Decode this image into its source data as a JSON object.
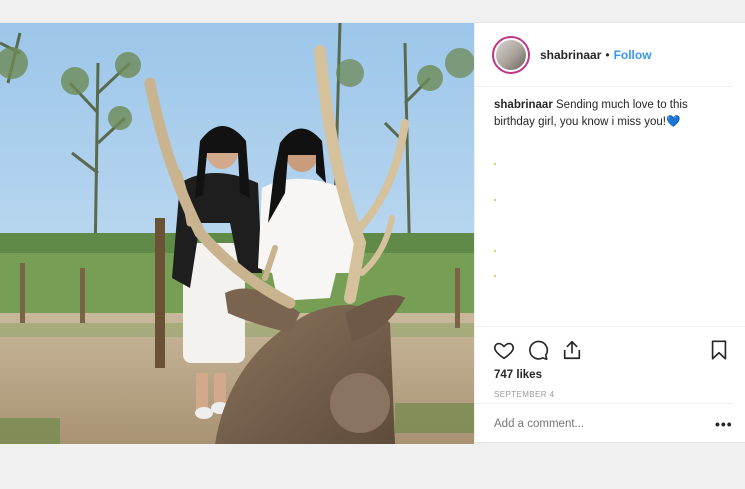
{
  "post": {
    "username": "shabrinaar",
    "separator": "•",
    "follow_label": "Follow",
    "caption_username": "shabrinaar",
    "caption_text": "Sending much love to this birthday girl, you know i miss you!",
    "caption_emoji": "💙",
    "likes": "747 likes",
    "date": "SEPTEMBER 4",
    "comment_placeholder": "Add a comment...",
    "more_label": "•••"
  },
  "colors": {
    "follow": "#3897f0",
    "text": "#262626",
    "muted": "#999999",
    "avatar_ring": "#c13584",
    "emoji_heart": "#29b6e8"
  },
  "icons": [
    "heart-icon",
    "comment-icon",
    "share-icon",
    "bookmark-icon",
    "more-options-icon"
  ]
}
